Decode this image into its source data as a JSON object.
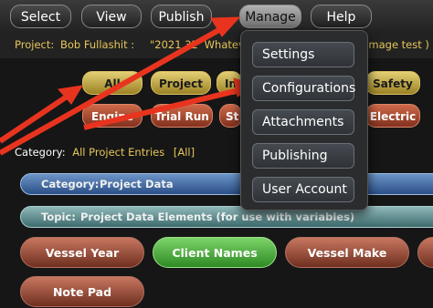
{
  "menubar": {
    "items": [
      "Select",
      "View",
      "Publish",
      "Manage",
      "Help"
    ]
  },
  "project": {
    "label": "Project:",
    "name": "Bob Fullashit :",
    "vessel_prefix": "\"2021 32' Whatever Y",
    "suffix": "Image test )"
  },
  "categories_row1": [
    "All",
    "Project",
    "Int",
    "Safety"
  ],
  "categories_row2": [
    "Engine",
    "Trial Run",
    "St",
    "Electric"
  ],
  "category_line": {
    "label": "Category:",
    "value": "All Project Entries",
    "link": "All"
  },
  "bars": {
    "category_label": "Category:",
    "category_value": "Project Data",
    "topic_label": "Topic:",
    "topic_value": "Project Data Elements (for use with variables)"
  },
  "fields": [
    "Vessel Year",
    "Client Names",
    "Vessel Make",
    "Note Pad"
  ],
  "dropdown": {
    "items": [
      "Settings",
      "Configurations",
      "Attachments",
      "Publishing",
      "User Account"
    ]
  },
  "colors": {
    "arrow": "#e8341f",
    "gold_text": "#e7c65a"
  }
}
